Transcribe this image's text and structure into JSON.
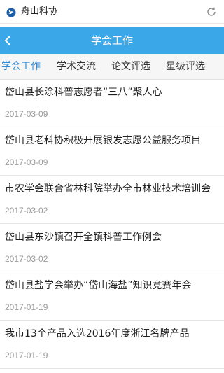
{
  "browser": {
    "address_text": "舟山科协",
    "site_icon": "site-logo-icon",
    "refresh_icon": "refresh-icon"
  },
  "header": {
    "title": "学会工作",
    "back_icon": "chevron-left-icon",
    "background": "#3aa7e8"
  },
  "tabs": [
    {
      "label": "学会工作",
      "active": true
    },
    {
      "label": "学术交流",
      "active": false
    },
    {
      "label": "论文评选",
      "active": false
    },
    {
      "label": "星级评选",
      "active": false
    }
  ],
  "accent_color": "#2f8ad8",
  "news": [
    {
      "title": "岱山县长涂科普志愿者“三八”聚人心",
      "date": "2017-03-09"
    },
    {
      "title": "岱山县老科协积极开展银发志愿公益服务项目",
      "date": "2017-03-09"
    },
    {
      "title": "市农学会联合省林科院举办全市林业技术培训会",
      "date": "2017-03-02"
    },
    {
      "title": "岱山县东沙镇召开全镇科普工作例会",
      "date": "2017-03-02"
    },
    {
      "title": "岱山县盐学会举办“岱山海盐”知识竞赛年会",
      "date": "2017-01-19"
    },
    {
      "title": "我市13个产品入选2016年度浙江名牌产品",
      "date": "2017-01-19"
    }
  ]
}
